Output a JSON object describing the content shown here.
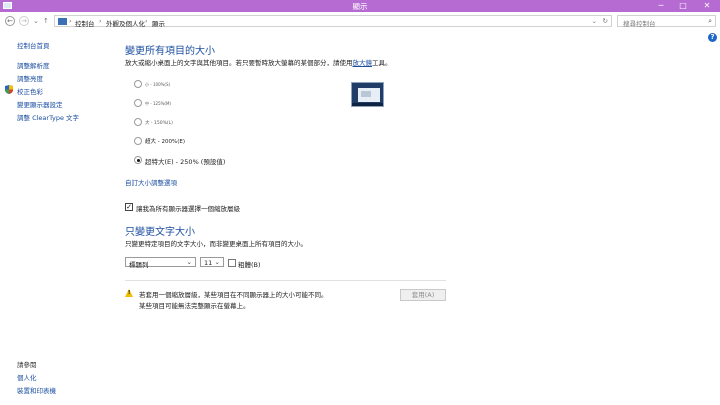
{
  "window": {
    "title": "顯示"
  },
  "address": {
    "crumbs": [
      "控制台",
      "外觀及個人化",
      "顯示"
    ],
    "search_placeholder": "搜尋控制台"
  },
  "sidebar": {
    "home": "控制台首頁",
    "items": [
      "調整解析度",
      "調整亮度",
      "校正色彩",
      "變更顯示器設定",
      "調整 ClearType 文字"
    ],
    "see_also_header": "請參閱",
    "see_also": [
      "個人化",
      "裝置和印表機"
    ]
  },
  "main": {
    "heading1": "變更所有項目的大小",
    "desc1_pre": "放大或縮小桌面上的文字與其他項目。若只要暫時放大螢幕的某個部分，請使用",
    "desc1_link": "放大鏡",
    "desc1_post": "工具。",
    "options": [
      "小 - 100%(S)",
      "中 - 125%(M)",
      "大 - 150%(L)",
      "超大 - 200%(E)",
      "超特大(E) - 250% (預設值)"
    ],
    "custom_link": "自訂大小調整選項",
    "per_display_checkbox": "讓我為所有顯示器選擇一個縮放層級",
    "heading2": "只變更文字大小",
    "desc2": "只變更特定項目的文字大小，而非變更桌面上所有項目的大小。",
    "item_select": "標題列",
    "size_select": "11",
    "bold_label": "粗體(B)",
    "warning_line1": "若套用一個縮放層級，某些項目在不同顯示器上的大小可能不同。",
    "warning_line2": "某些項目可能無法完整顯示在螢幕上。",
    "apply": "套用(A)"
  }
}
